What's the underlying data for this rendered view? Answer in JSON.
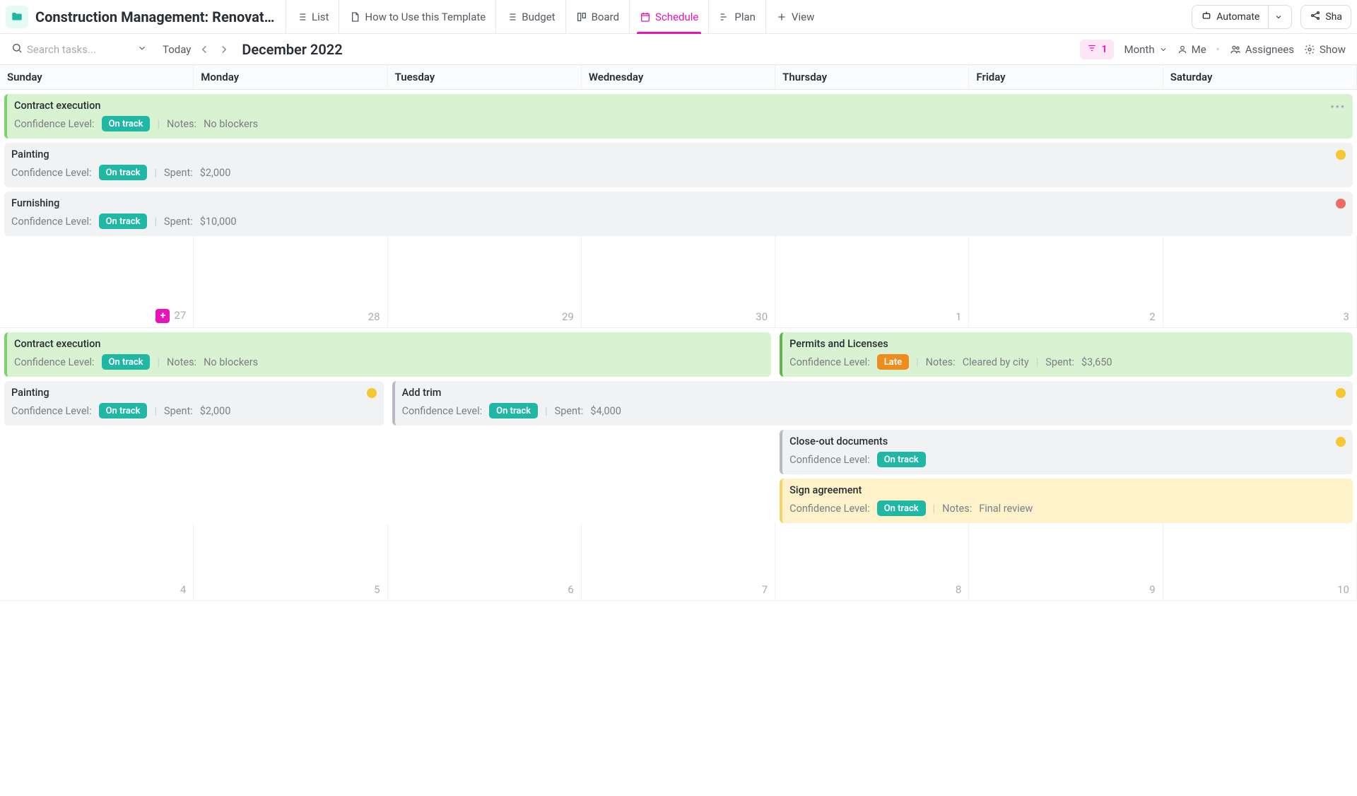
{
  "header": {
    "title": "Construction Management: Renovatio…",
    "tabs": [
      {
        "label": "List"
      },
      {
        "label": "How to Use this Template"
      },
      {
        "label": "Budget"
      },
      {
        "label": "Board"
      },
      {
        "label": "Schedule",
        "active": true
      },
      {
        "label": "Plan"
      },
      {
        "label": "View"
      }
    ],
    "automate": "Automate",
    "share": "Sha"
  },
  "subbar": {
    "search_placeholder": "Search tasks...",
    "today": "Today",
    "month": "December 2022",
    "filter_count": "1",
    "view_label": "Month",
    "me": "Me",
    "assignees": "Assignees",
    "show": "Show"
  },
  "days": [
    "Sunday",
    "Monday",
    "Tuesday",
    "Wednesday",
    "Thursday",
    "Friday",
    "Saturday"
  ],
  "week1_nums": [
    "27",
    "28",
    "29",
    "30",
    "1",
    "2",
    "3"
  ],
  "week2_nums": [
    "4",
    "5",
    "6",
    "7",
    "8",
    "9",
    "10"
  ],
  "labels": {
    "confidence": "Confidence Level:",
    "notes": "Notes:",
    "spent": "Spent:",
    "on_track": "On track",
    "late": "Late"
  },
  "w1": {
    "contract": {
      "title": "Contract execution",
      "notes": "No blockers"
    },
    "painting": {
      "title": "Painting",
      "spent": "$2,000"
    },
    "furnishing": {
      "title": "Furnishing",
      "spent": "$10,000"
    }
  },
  "w2": {
    "contract": {
      "title": "Contract execution",
      "notes": "No blockers"
    },
    "permits": {
      "title": "Permits and Licenses",
      "notes": "Cleared by city",
      "spent": "$3,650"
    },
    "painting": {
      "title": "Painting",
      "spent": "$2,000"
    },
    "addtrim": {
      "title": "Add trim",
      "spent": "$4,000"
    },
    "closeout": {
      "title": "Close-out documents"
    },
    "sign": {
      "title": "Sign agreement",
      "notes": "Final review"
    }
  }
}
